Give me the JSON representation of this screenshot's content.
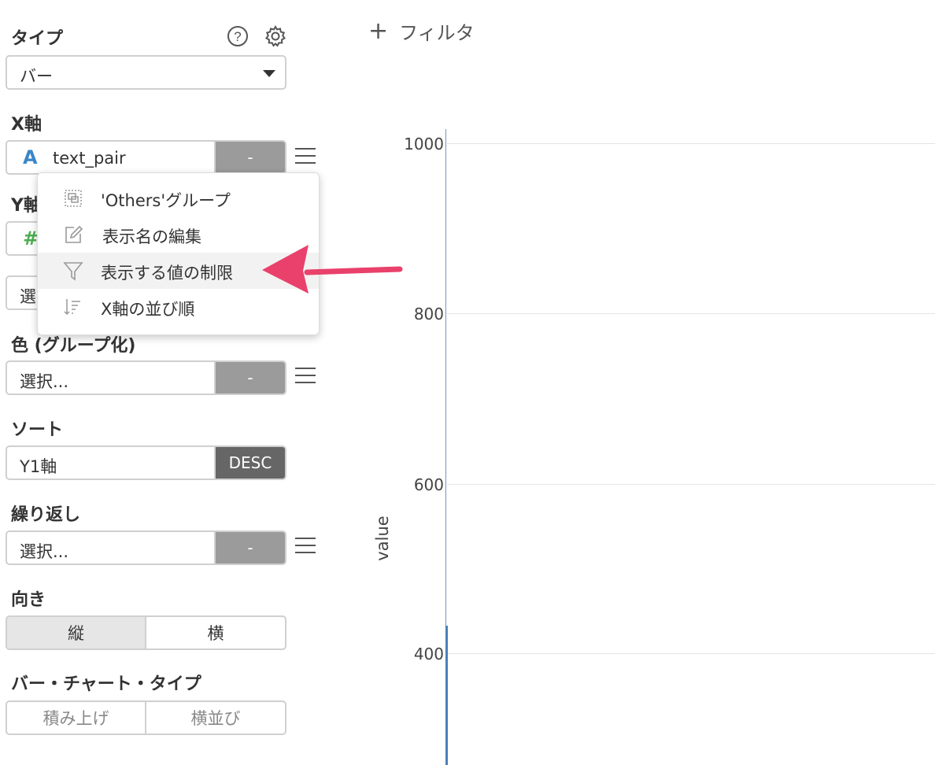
{
  "panel": {
    "type_label": "タイプ",
    "type_value": "バー",
    "x_axis_label": "X軸",
    "x_axis_field_icon": "A",
    "x_axis_field": "text_pair",
    "x_axis_btn": "-",
    "y_axis_label_partial": "Y軸",
    "y_axis_icon_partial": "#",
    "select_partial": "選",
    "color_label": "色 (グループ化)",
    "color_value": "選択...",
    "color_btn": "-",
    "sort_label": "ソート",
    "sort_value": "Y1軸",
    "sort_btn": "DESC",
    "repeat_label": "繰り返し",
    "repeat_value": "選択...",
    "repeat_btn": "-",
    "orient_label": "向き",
    "orient_vertical": "縦",
    "orient_horizontal": "横",
    "bartype_label": "バー・チャート・タイプ",
    "bartype_stacked": "積み上げ",
    "bartype_side": "横並び"
  },
  "menu": {
    "items": [
      {
        "label": "'Others'グループ",
        "icon": "group-box-icon"
      },
      {
        "label": "表示名の編集",
        "icon": "edit-icon"
      },
      {
        "label": "表示する値の制限",
        "icon": "filter-icon"
      },
      {
        "label": "X軸の並び順",
        "icon": "sort-icon"
      }
    ]
  },
  "filter": {
    "label": "フィルタ",
    "plus": "+"
  },
  "colors": {
    "arrow": "#e9416b",
    "axis_line": "#4a7fb5",
    "x_icon": "#3a86c8",
    "y_icon": "#4caf50"
  },
  "chart_data": {
    "type": "bar",
    "ylabel": "value",
    "yticks": [
      1000,
      800,
      600,
      400
    ],
    "ylim": [
      260,
      1020
    ],
    "grid": true,
    "series_visible_value": 435
  }
}
